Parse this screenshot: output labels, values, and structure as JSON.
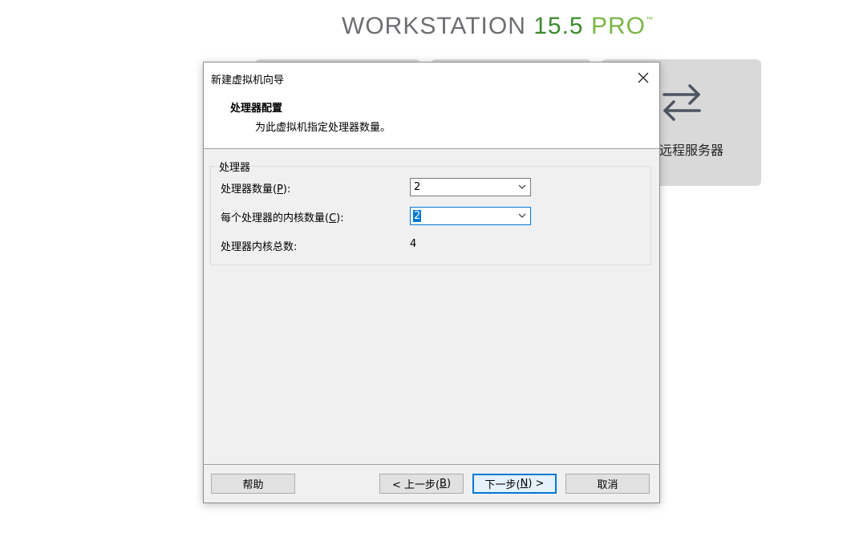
{
  "brand": {
    "name": "WORKSTATION ",
    "version": "15.5",
    "edition": " PRO",
    "tm": "™"
  },
  "background": {
    "remote_server_label": "远程服务器",
    "remote_icon": "swap-arrows-icon"
  },
  "dialog": {
    "title": "新建虚拟机向导",
    "close_icon": "close-icon",
    "header": {
      "title": "处理器配置",
      "subtitle": "为此虚拟机指定处理器数量。"
    },
    "group": {
      "legend": "处理器",
      "processor_count": {
        "label_prefix": "处理器数量(",
        "hotkey": "P",
        "label_suffix": "):",
        "value": "2"
      },
      "cores_per_processor": {
        "label_prefix": "每个处理器的内核数量(",
        "hotkey": "C",
        "label_suffix": "):",
        "value": "2"
      },
      "total_cores": {
        "label": "处理器内核总数:",
        "value": "4"
      }
    },
    "buttons": {
      "help": "帮助",
      "back_prefix": "< 上一步(",
      "back_hotkey": "B",
      "back_suffix": ")",
      "next_prefix": "下一步(",
      "next_hotkey": "N",
      "next_suffix": ") >",
      "cancel": "取消"
    }
  },
  "colors": {
    "focus_accent": "#0078d7",
    "brand_green": "#3c8a2e",
    "brand_light_green": "#7ab648"
  }
}
